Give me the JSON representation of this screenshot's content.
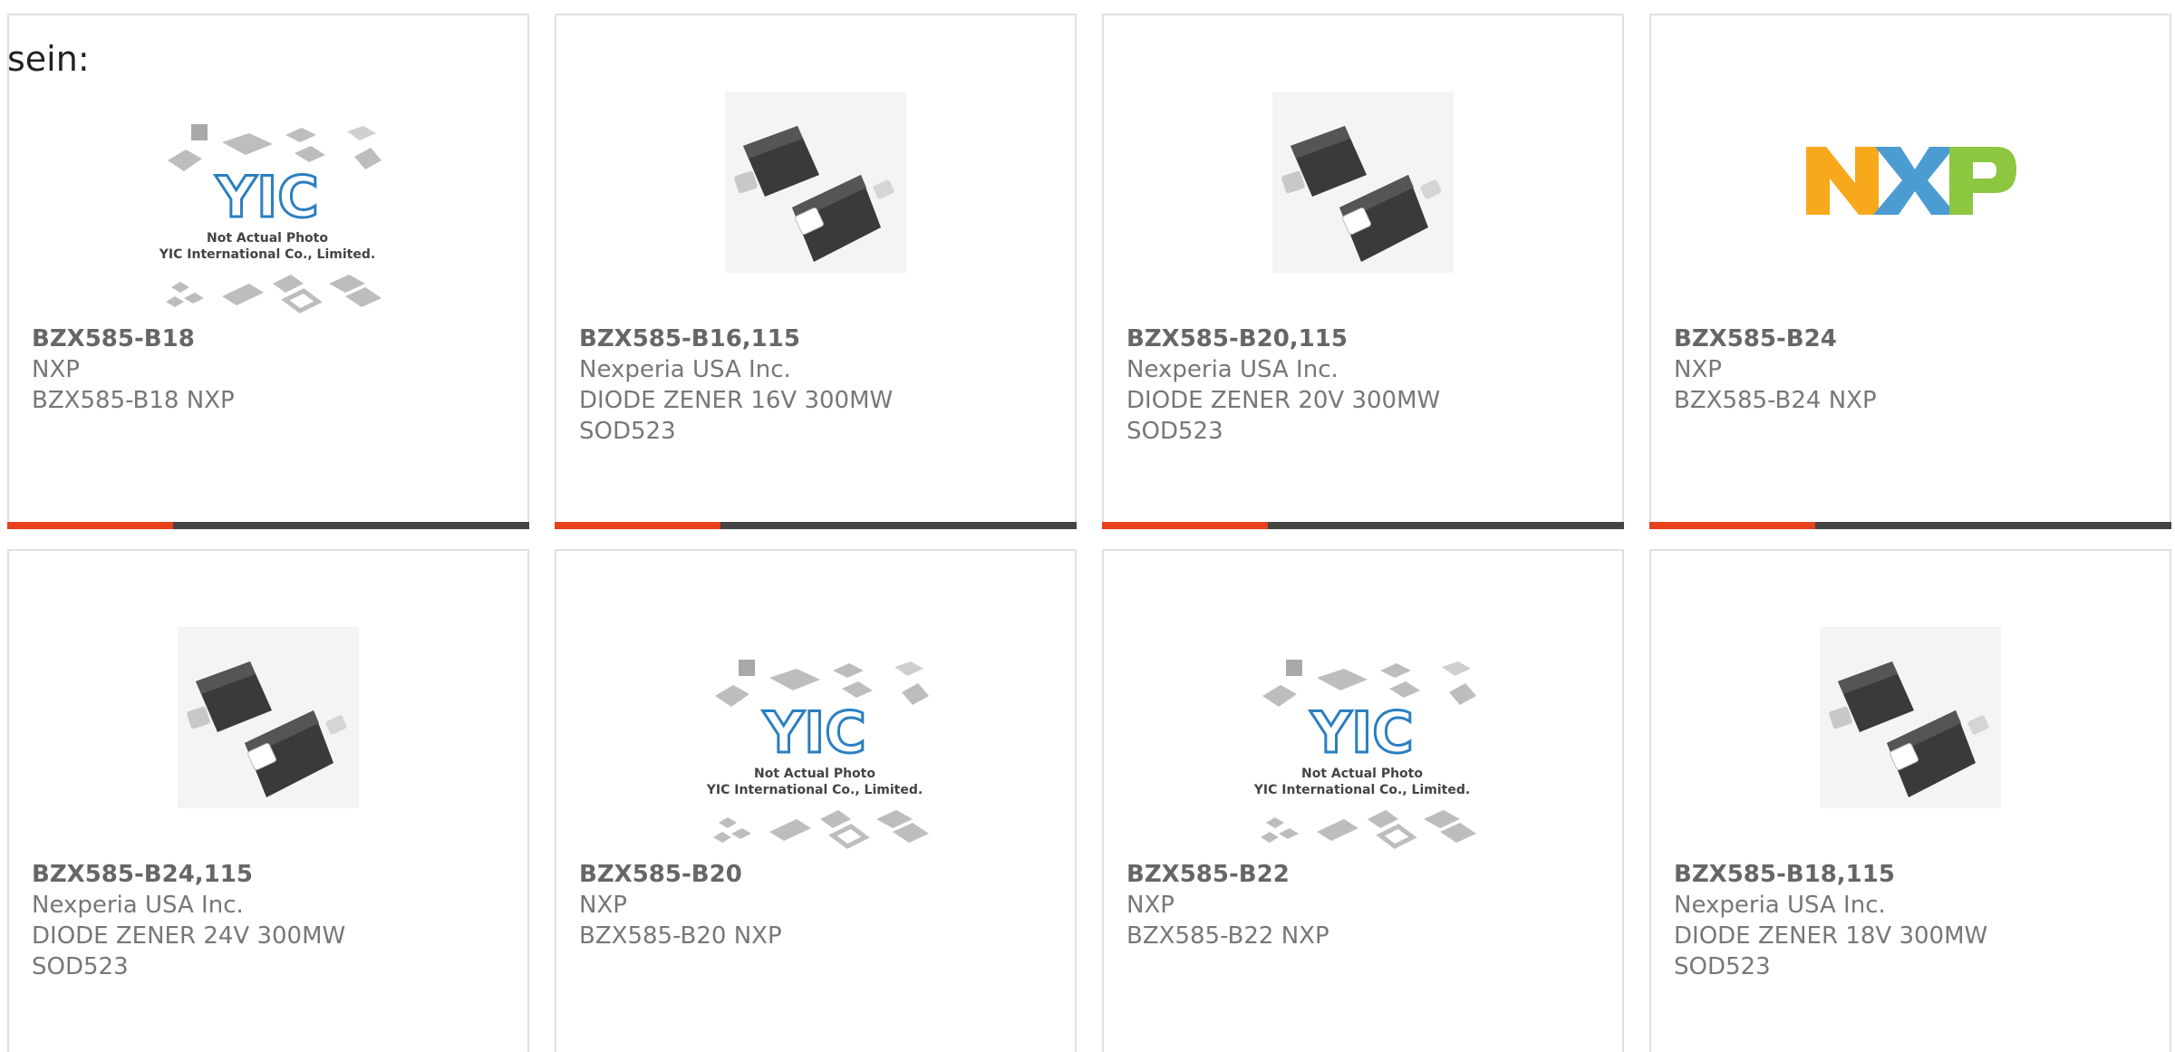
{
  "intro": {
    "text": "sein:"
  },
  "colors": {
    "accent": "#e8401c",
    "bar": "#444444",
    "border": "#e0e0e0",
    "text": "#777777"
  },
  "products": [
    {
      "pn": "BZX585-B18",
      "lines": [
        "NXP",
        "BZX585-B18 NXP"
      ],
      "image": "yic-not-actual-photo"
    },
    {
      "pn": "BZX585-B16,115",
      "lines": [
        "Nexperia USA Inc.",
        "DIODE ZENER 16V 300MW",
        "SOD523"
      ],
      "image": "sod523-diode-photo"
    },
    {
      "pn": "BZX585-B20,115",
      "lines": [
        "Nexperia USA Inc.",
        "DIODE ZENER 20V 300MW",
        "SOD523"
      ],
      "image": "sod523-diode-photo"
    },
    {
      "pn": "BZX585-B24",
      "lines": [
        "NXP",
        "BZX585-B24 NXP"
      ],
      "image": "nxp-logo"
    },
    {
      "pn": "BZX585-B24,115",
      "lines": [
        "Nexperia USA Inc.",
        "DIODE ZENER 24V 300MW",
        "SOD523"
      ],
      "image": "sod523-diode-photo"
    },
    {
      "pn": "BZX585-B20",
      "lines": [
        "NXP",
        "BZX585-B20 NXP"
      ],
      "image": "yic-not-actual-photo"
    },
    {
      "pn": "BZX585-B22",
      "lines": [
        "NXP",
        "BZX585-B22 NXP"
      ],
      "image": "yic-not-actual-photo"
    },
    {
      "pn": "BZX585-B18,115",
      "lines": [
        "Nexperia USA Inc.",
        "DIODE ZENER 18V 300MW",
        "SOD523"
      ],
      "image": "sod523-diode-photo"
    }
  ],
  "placeholder_image": {
    "logo_text": "YIC",
    "caption_line1": "Not Actual Photo",
    "caption_line2": "YIC International Co., Limited."
  },
  "nxp_logo": {
    "letters": [
      "N",
      "X",
      "P"
    ],
    "colors": [
      "#f7a81b",
      "#4b9cd3",
      "#8dc63f"
    ]
  }
}
